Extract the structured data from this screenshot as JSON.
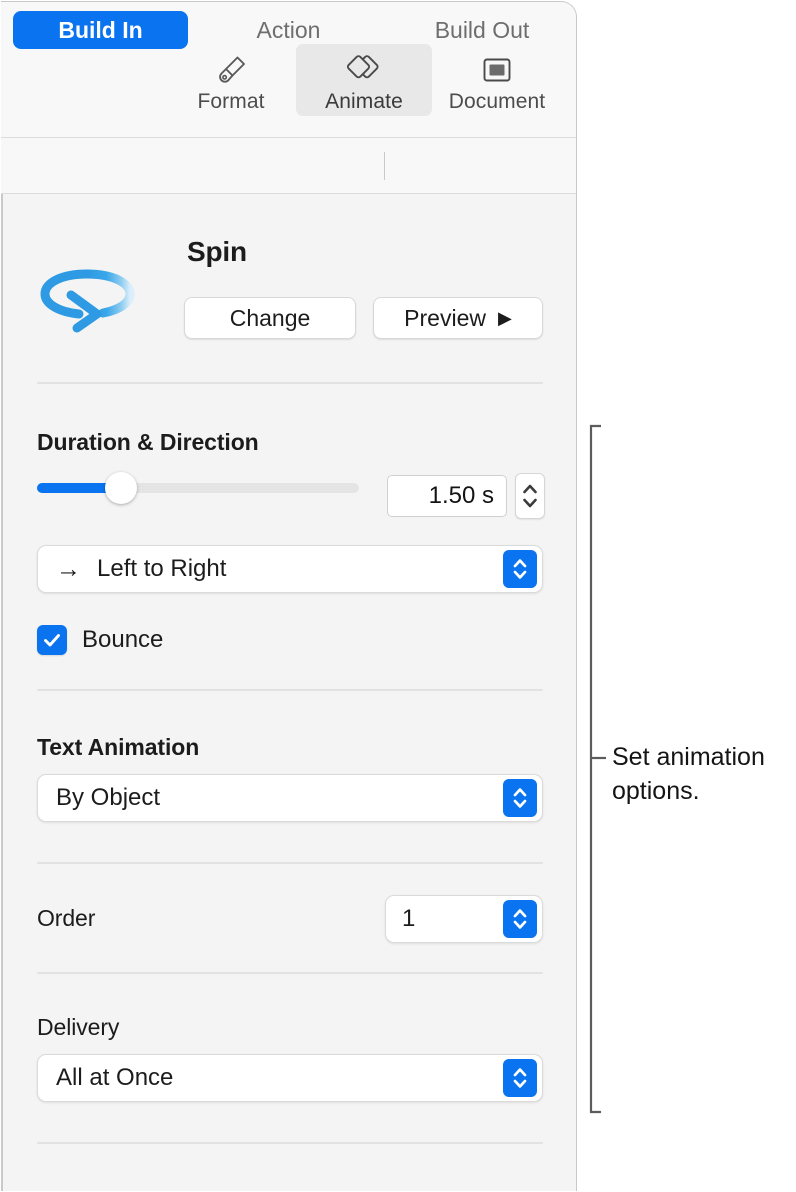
{
  "panel": {
    "mode_tabs": [
      {
        "label": "Format",
        "icon": "paintbrush-icon",
        "selected": false
      },
      {
        "label": "Animate",
        "icon": "animate-diamonds-icon",
        "selected": true
      },
      {
        "label": "Document",
        "icon": "document-icon",
        "selected": false
      }
    ],
    "build_tabs": [
      {
        "label": "Build In",
        "selected": true
      },
      {
        "label": "Action",
        "selected": false
      },
      {
        "label": "Build Out",
        "selected": false
      }
    ],
    "effect": {
      "name": "Spin",
      "icon": "spin-circular-arrow-icon",
      "change_label": "Change",
      "preview_label": "Preview",
      "preview_play_glyph": "▶"
    },
    "duration_direction": {
      "label": "Duration & Direction",
      "duration_value": "1.50 s",
      "slider_percent": 26,
      "direction_value": "Left to Right",
      "direction_arrow_glyph": "→",
      "bounce_label": "Bounce",
      "bounce_checked": true,
      "check_glyph": "✓"
    },
    "text_animation": {
      "label": "Text Animation",
      "value": "By Object"
    },
    "order": {
      "label": "Order",
      "value": "1"
    },
    "delivery": {
      "label": "Delivery",
      "value": "All at Once"
    }
  },
  "callout": {
    "text": "Set animation options."
  },
  "colors": {
    "accent_blue": "#0a74f0",
    "panel_bg": "#f4f4f4",
    "toolbar_bg": "#f8f8f8",
    "separator": "#e2e2e2",
    "text_primary": "#1c1c1c",
    "text_secondary": "#6e6e6e"
  }
}
